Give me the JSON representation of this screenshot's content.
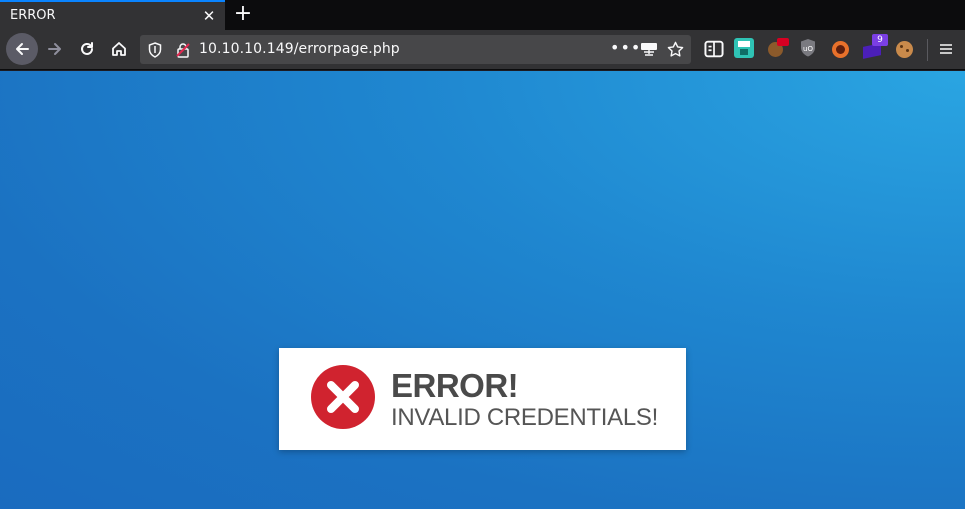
{
  "tab": {
    "title": "ERROR"
  },
  "urlbar": {
    "url": "10.10.10.149/errorpage.php"
  },
  "extensions": {
    "badge_count": "9"
  },
  "error_box": {
    "title": "ERROR!",
    "message": "INVALID CREDENTIALS!"
  },
  "colors": {
    "accent": "#0a84ff",
    "error_red": "#d0232f",
    "background_blue": "#1f87d0"
  },
  "icons": [
    "arrow-left-icon",
    "arrow-right-icon",
    "reload-icon",
    "home-icon",
    "shield-icon",
    "insecure-lock-icon",
    "more-icon",
    "screenshot-icon",
    "star-icon",
    "reader-icon",
    "save-icon",
    "cookie-icon",
    "ublock-icon",
    "firefox-extension-icon",
    "badge-extension-icon",
    "cookie-icon",
    "menu-icon",
    "close-icon",
    "plus-icon",
    "x-icon"
  ]
}
